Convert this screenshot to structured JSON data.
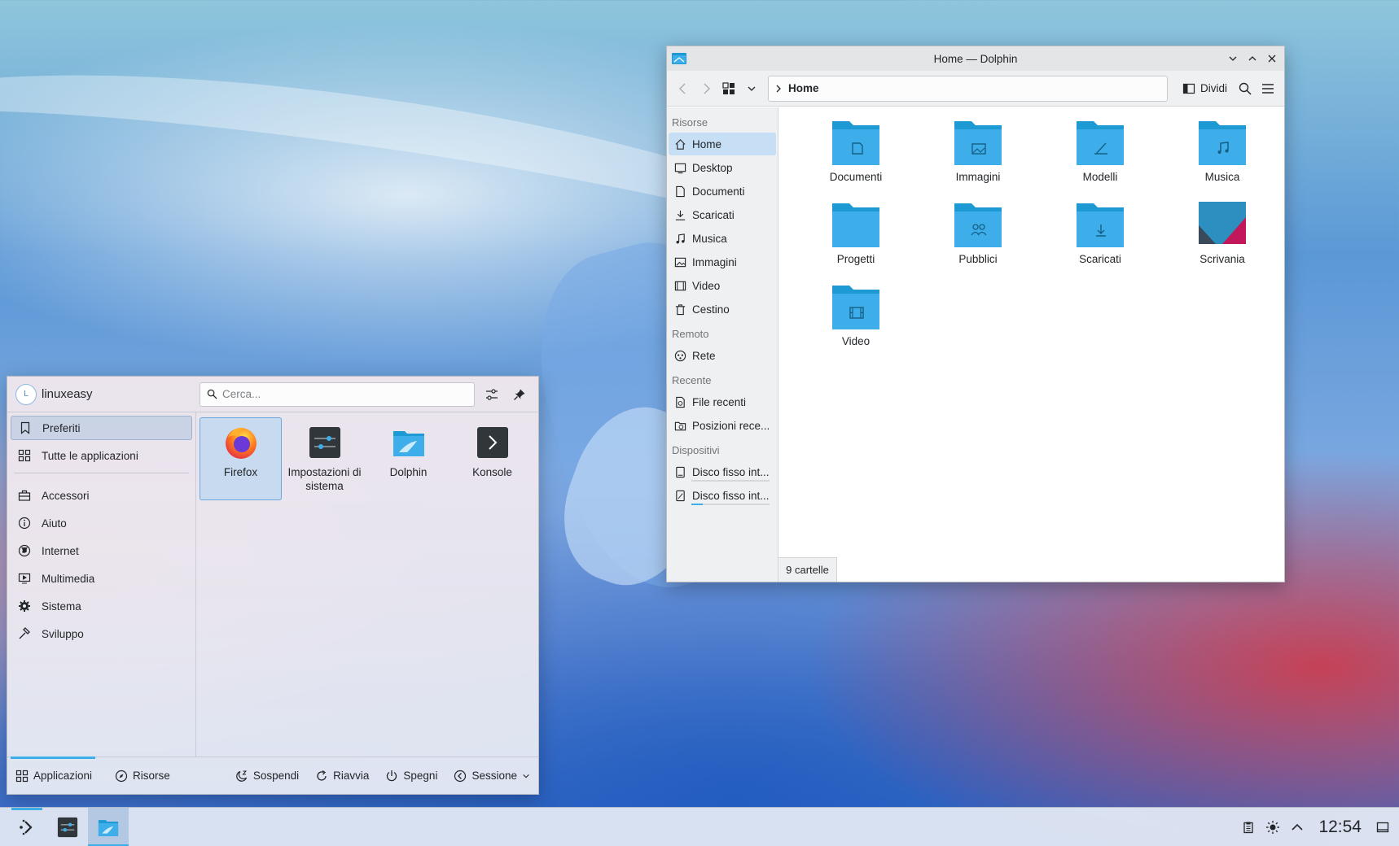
{
  "dolphin": {
    "window_title": "Home — Dolphin",
    "breadcrumb": "Home",
    "split_label": "Dividi",
    "places": {
      "section_resources": "Risorse",
      "resources": [
        "Home",
        "Desktop",
        "Documenti",
        "Scaricati",
        "Musica",
        "Immagini",
        "Video",
        "Cestino"
      ],
      "section_remote": "Remoto",
      "remote": [
        "Rete"
      ],
      "section_recent": "Recente",
      "recent": [
        "File recenti",
        "Posizioni rece..."
      ],
      "section_devices": "Dispositivi",
      "devices": [
        "Disco fisso int...",
        "Disco fisso int..."
      ],
      "device_usage": [
        0.0,
        0.15
      ]
    },
    "folders": [
      "Documenti",
      "Immagini",
      "Modelli",
      "Musica",
      "Progetti",
      "Pubblici",
      "Scaricati",
      "Scrivania",
      "Video"
    ],
    "status": "9 cartelle"
  },
  "kickoff": {
    "user_name": "linuxeasy",
    "avatar_initial": "L",
    "search_placeholder": "Cerca...",
    "categories": [
      "Preferiti",
      "Tutte le applicazioni"
    ],
    "app_categories": [
      "Accessori",
      "Aiuto",
      "Internet",
      "Multimedia",
      "Sistema",
      "Sviluppo"
    ],
    "favorites": [
      "Firefox",
      "Impostazioni di sistema",
      "Dolphin",
      "Konsole"
    ],
    "footer": {
      "applications": "Applicazioni",
      "places": "Risorse",
      "suspend": "Sospendi",
      "restart": "Riavvia",
      "shutdown": "Spegni",
      "session": "Sessione"
    }
  },
  "panel": {
    "clock": "12:54"
  },
  "colors": {
    "accent": "#3daee9",
    "folder": "#3daee9",
    "folder_dark": "#1d99d3"
  }
}
